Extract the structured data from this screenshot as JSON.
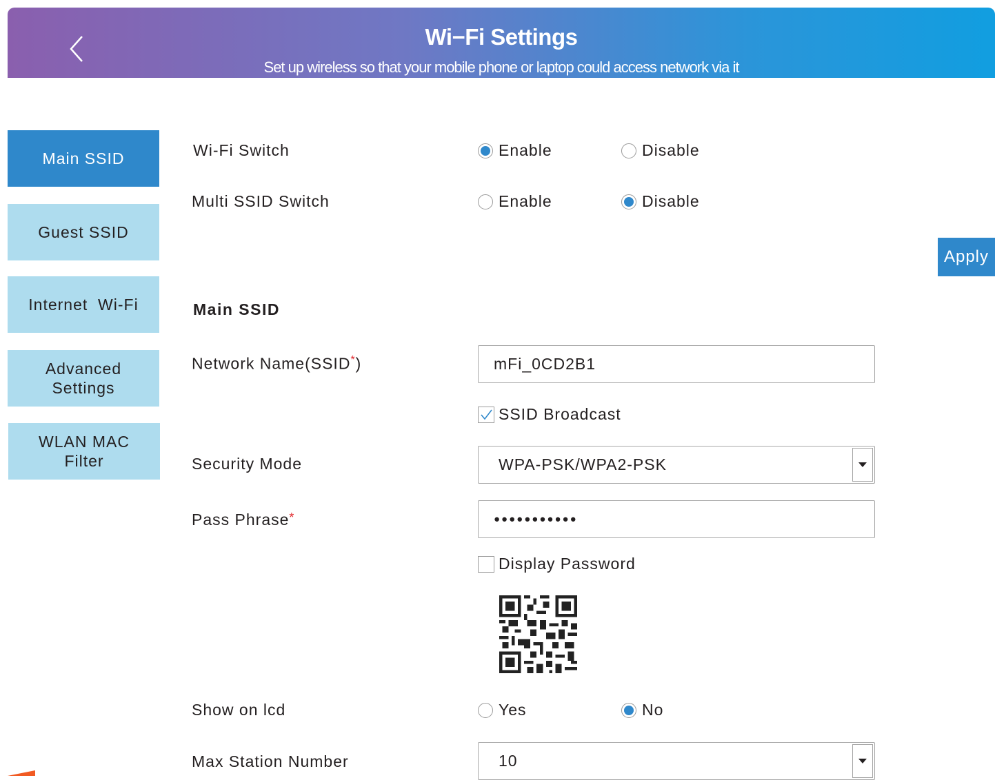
{
  "header": {
    "title": "Wi−Fi Settings",
    "subtitle": "Set up wireless so that your mobile phone or laptop could access network via it",
    "back_icon": "chevron-left-icon"
  },
  "sidebar": {
    "items": [
      {
        "label": "Main SSID",
        "active": true
      },
      {
        "label": "Guest SSID",
        "active": false
      },
      {
        "label": "Internet  Wi-Fi",
        "active": false
      },
      {
        "label": "Advanced Settings",
        "active": false
      },
      {
        "label": "WLAN MAC Filter",
        "active": false
      }
    ]
  },
  "wifi_switch": {
    "label": "Wi-Fi Switch",
    "enable": "Enable",
    "disable": "Disable",
    "selected": "Enable"
  },
  "multi_ssid_switch": {
    "label": "Multi SSID Switch",
    "enable": "Enable",
    "disable": "Disable",
    "selected": "Disable"
  },
  "apply_label": "Apply",
  "section_title": "Main SSID",
  "network_name": {
    "label": "Network Name(SSID",
    "required_mark": "*",
    "label_close": ")",
    "value": "mFi_0CD2B1"
  },
  "ssid_broadcast": {
    "label": "SSID Broadcast",
    "checked": true
  },
  "security_mode": {
    "label": "Security Mode",
    "value": "WPA-PSK/WPA2-PSK"
  },
  "pass_phrase": {
    "label": "Pass Phrase",
    "required_mark": "*",
    "value": "●●●●●●●●●●●"
  },
  "display_password": {
    "label": "Display Password",
    "checked": false
  },
  "qr_icon": "qr-code-icon",
  "show_on_lcd": {
    "label": "Show on lcd",
    "yes": "Yes",
    "no": "No",
    "selected": "No"
  },
  "max_station": {
    "label": "Max Station Number",
    "value": "10"
  },
  "colors": {
    "accent": "#2f88cb",
    "sidebar_inactive": "#aedcee",
    "required": "#e0262b"
  }
}
